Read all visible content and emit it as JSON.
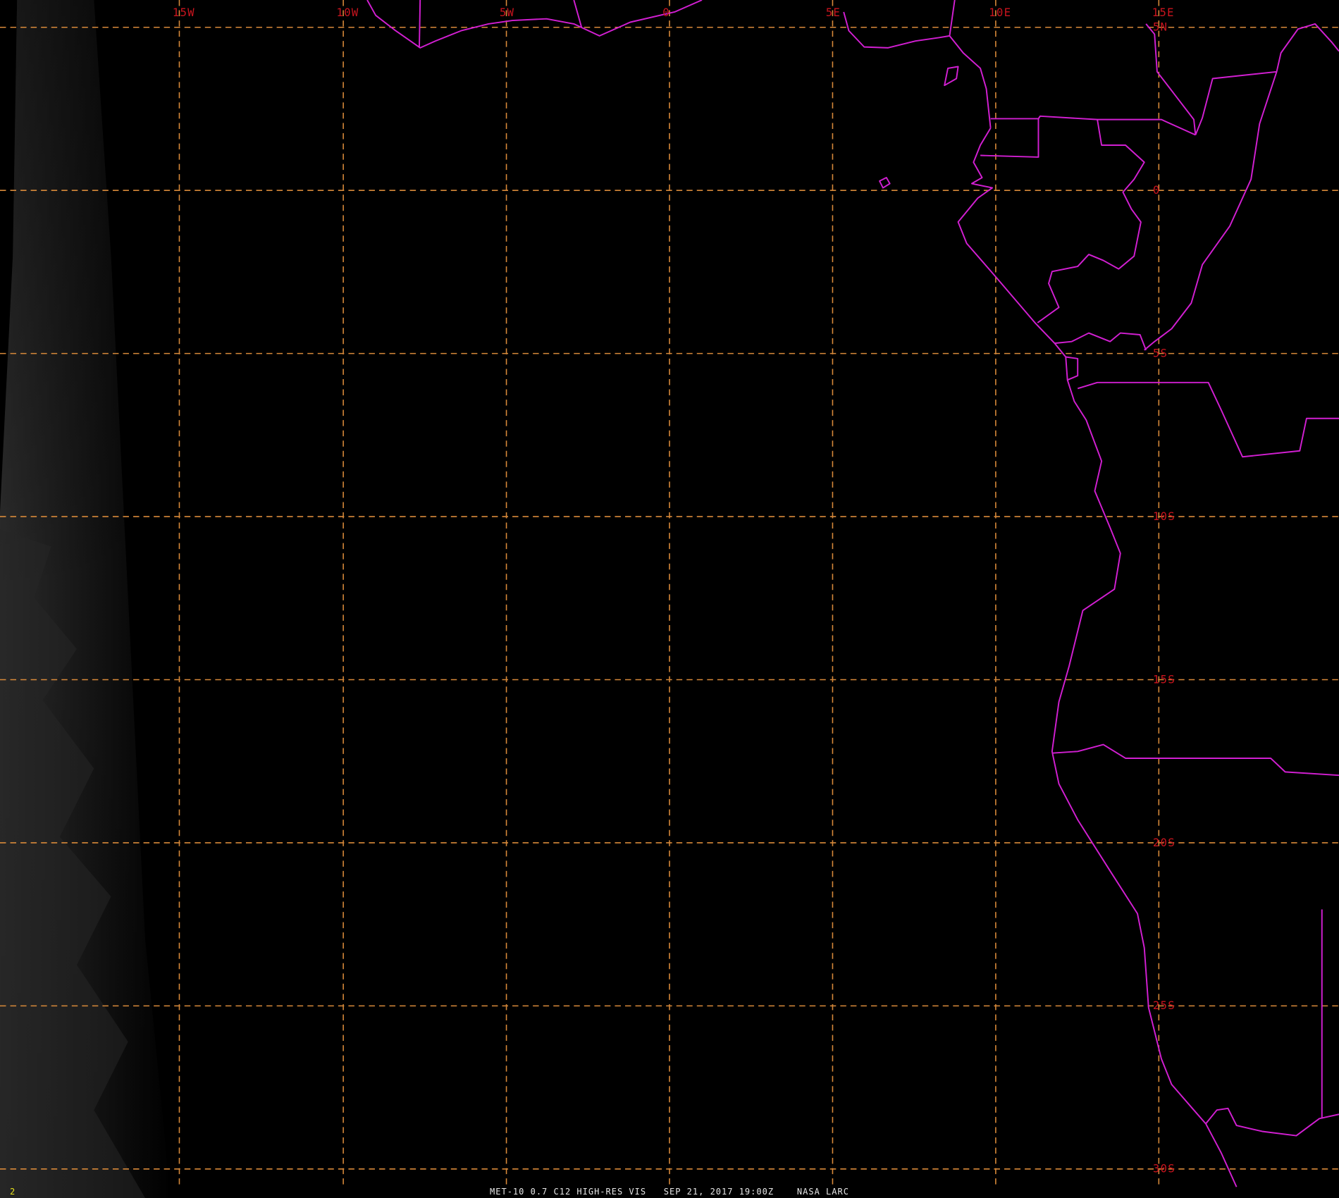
{
  "caption": {
    "satellite": "MET-10",
    "channel": "0.7 C12 HIGH-RES VIS",
    "datetime": "SEP 21, 2017 19:00Z",
    "source": "NASA LARC",
    "full_text": "MET-10 0.7 C12 HIGH-RES VIS   SEP 21, 2017 19:00Z    NASA LARC"
  },
  "frame_number": "2",
  "longitude_labels": [
    "15W",
    "10W",
    "5W",
    "0",
    "5E",
    "10E",
    "15E"
  ],
  "latitude_labels": [
    "5N",
    "0",
    "5S",
    "10S",
    "15S",
    "20S",
    "25S",
    "30S"
  ],
  "colors": {
    "background": "#000000",
    "graticule": "#d98a3a",
    "boundaries": "#d21fd2",
    "grid_labels": "#c8141e",
    "caption_text": "#e6e6e6",
    "frame_number": "#e7e21b"
  }
}
